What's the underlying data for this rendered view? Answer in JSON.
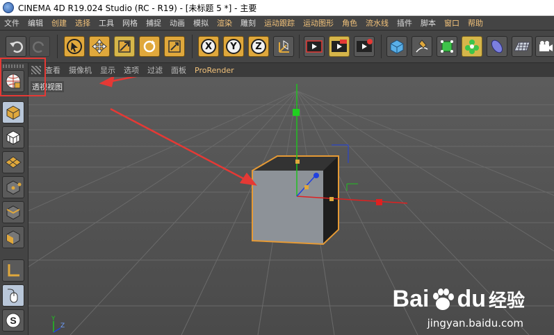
{
  "window": {
    "title": "CINEMA 4D R19.024 Studio (RC - R19) - [未标题 5 *] - 主要"
  },
  "menubar": {
    "items": [
      {
        "label": "文件",
        "gold": false
      },
      {
        "label": "编辑",
        "gold": false
      },
      {
        "label": "创建",
        "gold": true
      },
      {
        "label": "选择",
        "gold": true
      },
      {
        "label": "工具",
        "gold": false
      },
      {
        "label": "网格",
        "gold": false
      },
      {
        "label": "捕捉",
        "gold": false
      },
      {
        "label": "动画",
        "gold": false
      },
      {
        "label": "模拟",
        "gold": false
      },
      {
        "label": "渲染",
        "gold": true
      },
      {
        "label": "雕刻",
        "gold": false
      },
      {
        "label": "运动跟踪",
        "gold": true
      },
      {
        "label": "运动图形",
        "gold": true
      },
      {
        "label": "角色",
        "gold": true
      },
      {
        "label": "流水线",
        "gold": true
      },
      {
        "label": "插件",
        "gold": false
      },
      {
        "label": "脚本",
        "gold": false
      },
      {
        "label": "窗口",
        "gold": true
      },
      {
        "label": "帮助",
        "gold": true
      }
    ]
  },
  "toolbar": {
    "axes": {
      "x": "X",
      "y": "Y",
      "z": "Z"
    }
  },
  "viewport": {
    "menu": [
      "查看",
      "摄像机",
      "显示",
      "选项",
      "过滤",
      "面板"
    ],
    "renderer": "ProRender",
    "label": "透视视图"
  },
  "axis_gizmo": {
    "y": "Y",
    "z": "Z"
  },
  "watermark": {
    "bai": "Bai",
    "du": "du",
    "jingyan": "经验",
    "url": "jingyan.baidu.com"
  },
  "colors": {
    "accent": "#e0a83c",
    "selection": "#e69a35",
    "axis_x": "#e02020",
    "axis_y": "#20c020",
    "axis_z": "#2040e0",
    "annotation": "#e53935"
  }
}
